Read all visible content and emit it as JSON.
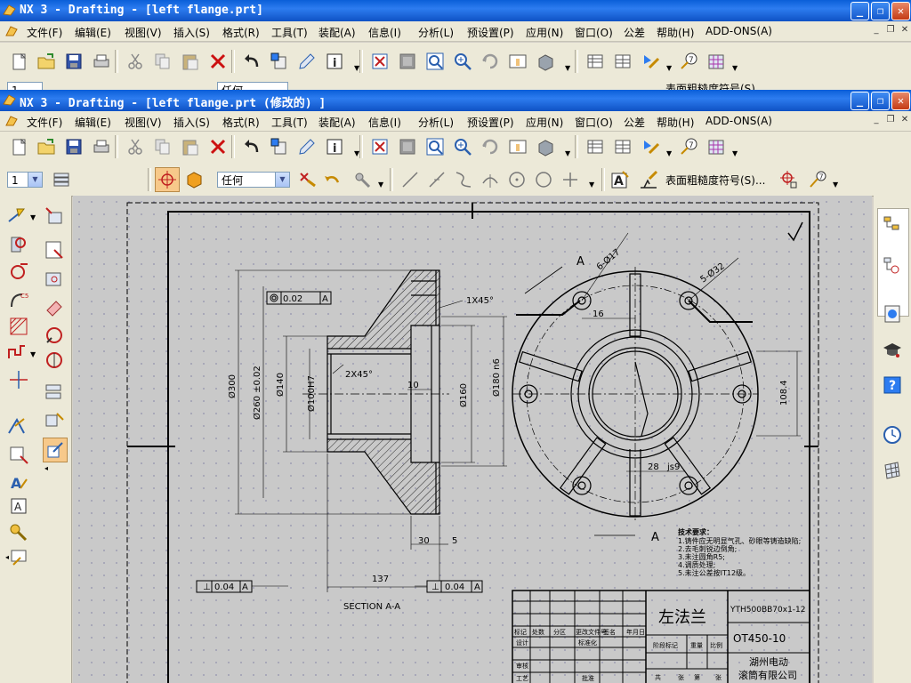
{
  "windows": {
    "back_title": "NX 3 - Drafting - [left flange.prt]",
    "front_title": "NX 3 - Drafting - [left flange.prt (修改的) ]"
  },
  "menu": [
    "文件(F)",
    "编辑(E)",
    "视图(V)",
    "插入(S)",
    "格式(R)",
    "工具(T)",
    "装配(A)",
    "信息(I)",
    "分析(L)",
    "预设置(P)",
    "应用(N)",
    "窗口(O)",
    "公差",
    "帮助(H)",
    "ADD-ONS(A)"
  ],
  "toolbar3": {
    "layer_value": "1",
    "snap_value": "任何",
    "surface_symbol_label": "表面粗糙度符号(S)..."
  },
  "drawing": {
    "gdt_flatness": "0.02",
    "gdt_datum_label": "A",
    "chamfer_top": "1X45°",
    "chamfer_inner": "2X45°",
    "dia_300": "Ø300",
    "dia_260": "Ø260 ±0.02",
    "dia_140": "Ø140",
    "dia_100": "Ø100H7",
    "dim_10": "10",
    "dia_160": "Ø160",
    "dia_180": "Ø180 n6",
    "dim_30": "30",
    "dim_5": "5",
    "dim_137": "137",
    "gdt_bottom_left": "0.04",
    "gdt_bottom_right": "0.04",
    "section_label": "SECTION A-A",
    "view_letter": "A",
    "holes_small": "6-Ø17",
    "holes_large": "5-Ø32",
    "dim_16": "16",
    "dim_108": "108.4",
    "dim_28": "28",
    "dim_js9": "js9",
    "tech_title": "技术要求：",
    "tech_notes": [
      "1.铸件应无明显气孔、砂眼等铸造缺陷;",
      "2.去毛刺锐边倒角;",
      "3.未注圆角R5;",
      "4.调质处理;",
      "5.未注公差按IT12级。"
    ],
    "title_name": "左法兰",
    "title_code1": "YTH500BB70x1-12",
    "title_code2": "OT450-10",
    "company_line1": "湖州电动",
    "company_line2": "滚筒有限公司",
    "tb_cells": [
      "标记",
      "处数",
      "分区",
      "更改文件号",
      "签名",
      "年月日",
      "设计",
      "标准化",
      "审核",
      "工艺",
      "批准",
      "阶段标记",
      "重量",
      "比例",
      "共",
      "张",
      "第",
      "张"
    ]
  }
}
